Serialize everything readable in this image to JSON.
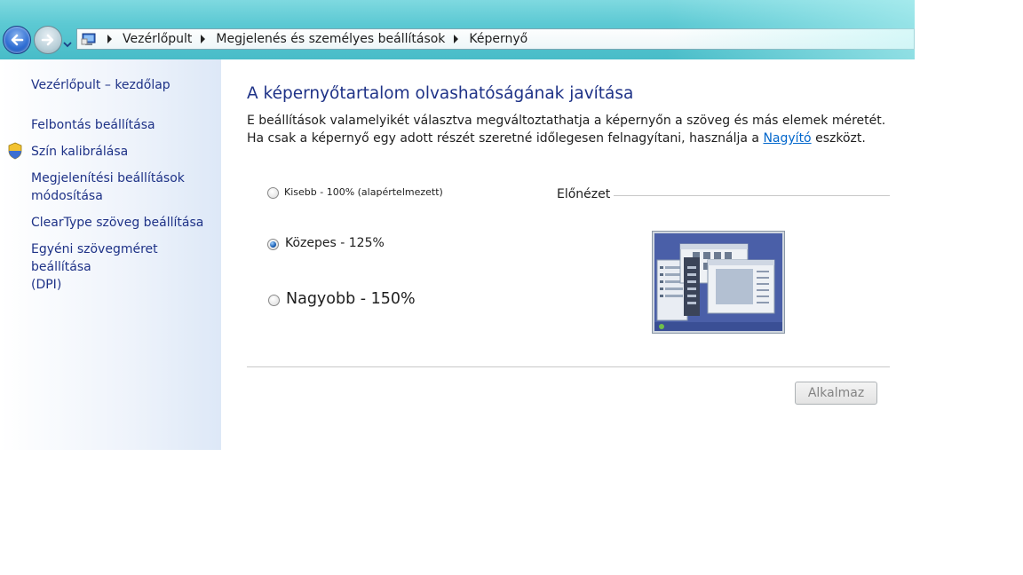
{
  "breadcrumb": {
    "items": [
      "Vezérlőpult",
      "Megjelenés és személyes beállítások",
      "Képernyő"
    ]
  },
  "sidebar": {
    "items": [
      {
        "label": "Vezérlőpult – kezdőlap"
      },
      {
        "label": "Felbontás beállítása"
      },
      {
        "label": "Szín kalibrálása"
      },
      {
        "label_line1": "Megjelenítési beállítások",
        "label_line2": "módosítása"
      },
      {
        "label": "ClearType szöveg beállítása"
      },
      {
        "label_line1": "Egyéni szövegméret beállítása",
        "label_line2": "(DPI)"
      }
    ]
  },
  "main": {
    "title": "A képernyőtartalom olvashatóságának javítása",
    "description_before": "E beállítások valamelyikét választva megváltoztathatja a képernyőn a szöveg és más elemek méretét. Ha csak a képernyő egy adott részét szeretné időlegesen felnagyítani, használja a ",
    "description_link": "Nagyító",
    "description_after": " eszközt.",
    "options": [
      {
        "label": "Kisebb - 100% (alapértelmezett)",
        "selected": false
      },
      {
        "label": "Közepes - 125%",
        "selected": true
      },
      {
        "label": "Nagyobb - 150%",
        "selected": false
      }
    ],
    "preview_label": "Előnézet",
    "apply_label": "Alkalmaz"
  },
  "colors": {
    "link": "#1e3287",
    "title_bar": "#5cc9d3",
    "sidebar_tint": "#dde8f7"
  },
  "icons": {
    "back": "back-arrow-icon",
    "forward": "forward-arrow-icon",
    "recent": "chevron-down-icon",
    "address": "control-panel-icon",
    "uac": "uac-shield-icon"
  }
}
